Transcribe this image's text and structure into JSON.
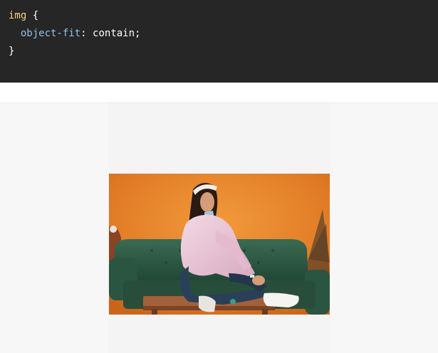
{
  "code": {
    "selector": "img",
    "open_brace": "{",
    "property": "object-fit",
    "colon": ":",
    "value": "contain",
    "semicolon": ";",
    "close_brace": "}"
  },
  "demo": {
    "image_alt": "Woman in pink jacket sitting on a wooden table in front of a green sofa and orange wall",
    "colors": {
      "wall": "#e7832a",
      "sofa": "#2f5a44",
      "jacket": "#e9c6d6",
      "jeans": "#25384d",
      "table": "#9a5a32"
    }
  }
}
